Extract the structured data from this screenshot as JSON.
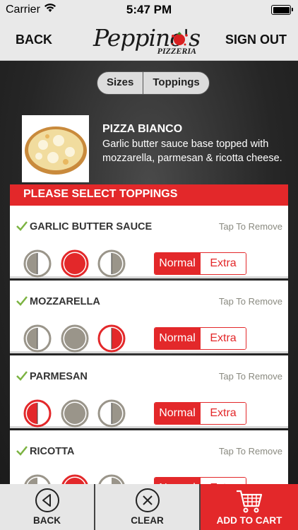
{
  "status_bar": {
    "carrier": "Carrier",
    "time": "5:47 PM"
  },
  "header": {
    "back_label": "BACK",
    "signout_label": "SIGN OUT",
    "logo_script": "Peppino's",
    "logo_sub": "PIZZERIA"
  },
  "segments": [
    "Sizes",
    "Toppings"
  ],
  "pizza": {
    "title": "PIZZA BIANCO",
    "description": "Garlic butter sauce base topped with mozzarella, parmesan & ricotta cheese."
  },
  "toppings_header": "PLEASE SELECT TOPPINGS",
  "toppings": [
    {
      "name": "GARLIC BUTTER SAUCE",
      "remove_label": "Tap To Remove",
      "portion_selected": "whole",
      "amount_selected": "Normal"
    },
    {
      "name": "MOZZARELLA",
      "remove_label": "Tap To Remove",
      "portion_selected": "right",
      "amount_selected": "Normal"
    },
    {
      "name": "PARMESAN",
      "remove_label": "Tap To Remove",
      "portion_selected": "left",
      "amount_selected": "Normal"
    },
    {
      "name": "RICOTTA",
      "remove_label": "Tap To Remove",
      "portion_selected": "whole",
      "amount_selected": "Normal"
    }
  ],
  "amount_options": [
    "Normal",
    "Extra"
  ],
  "toolbar": {
    "back_label": "BACK",
    "clear_label": "CLEAR",
    "cart_label": "ADD TO CART"
  },
  "colors": {
    "accent": "#e3282a",
    "header_bg": "#e9e9e9",
    "check_green": "#7cb342"
  },
  "icons": {
    "back": "left-arrow-circle-icon",
    "clear": "x-circle-icon",
    "cart": "shopping-cart-icon"
  }
}
